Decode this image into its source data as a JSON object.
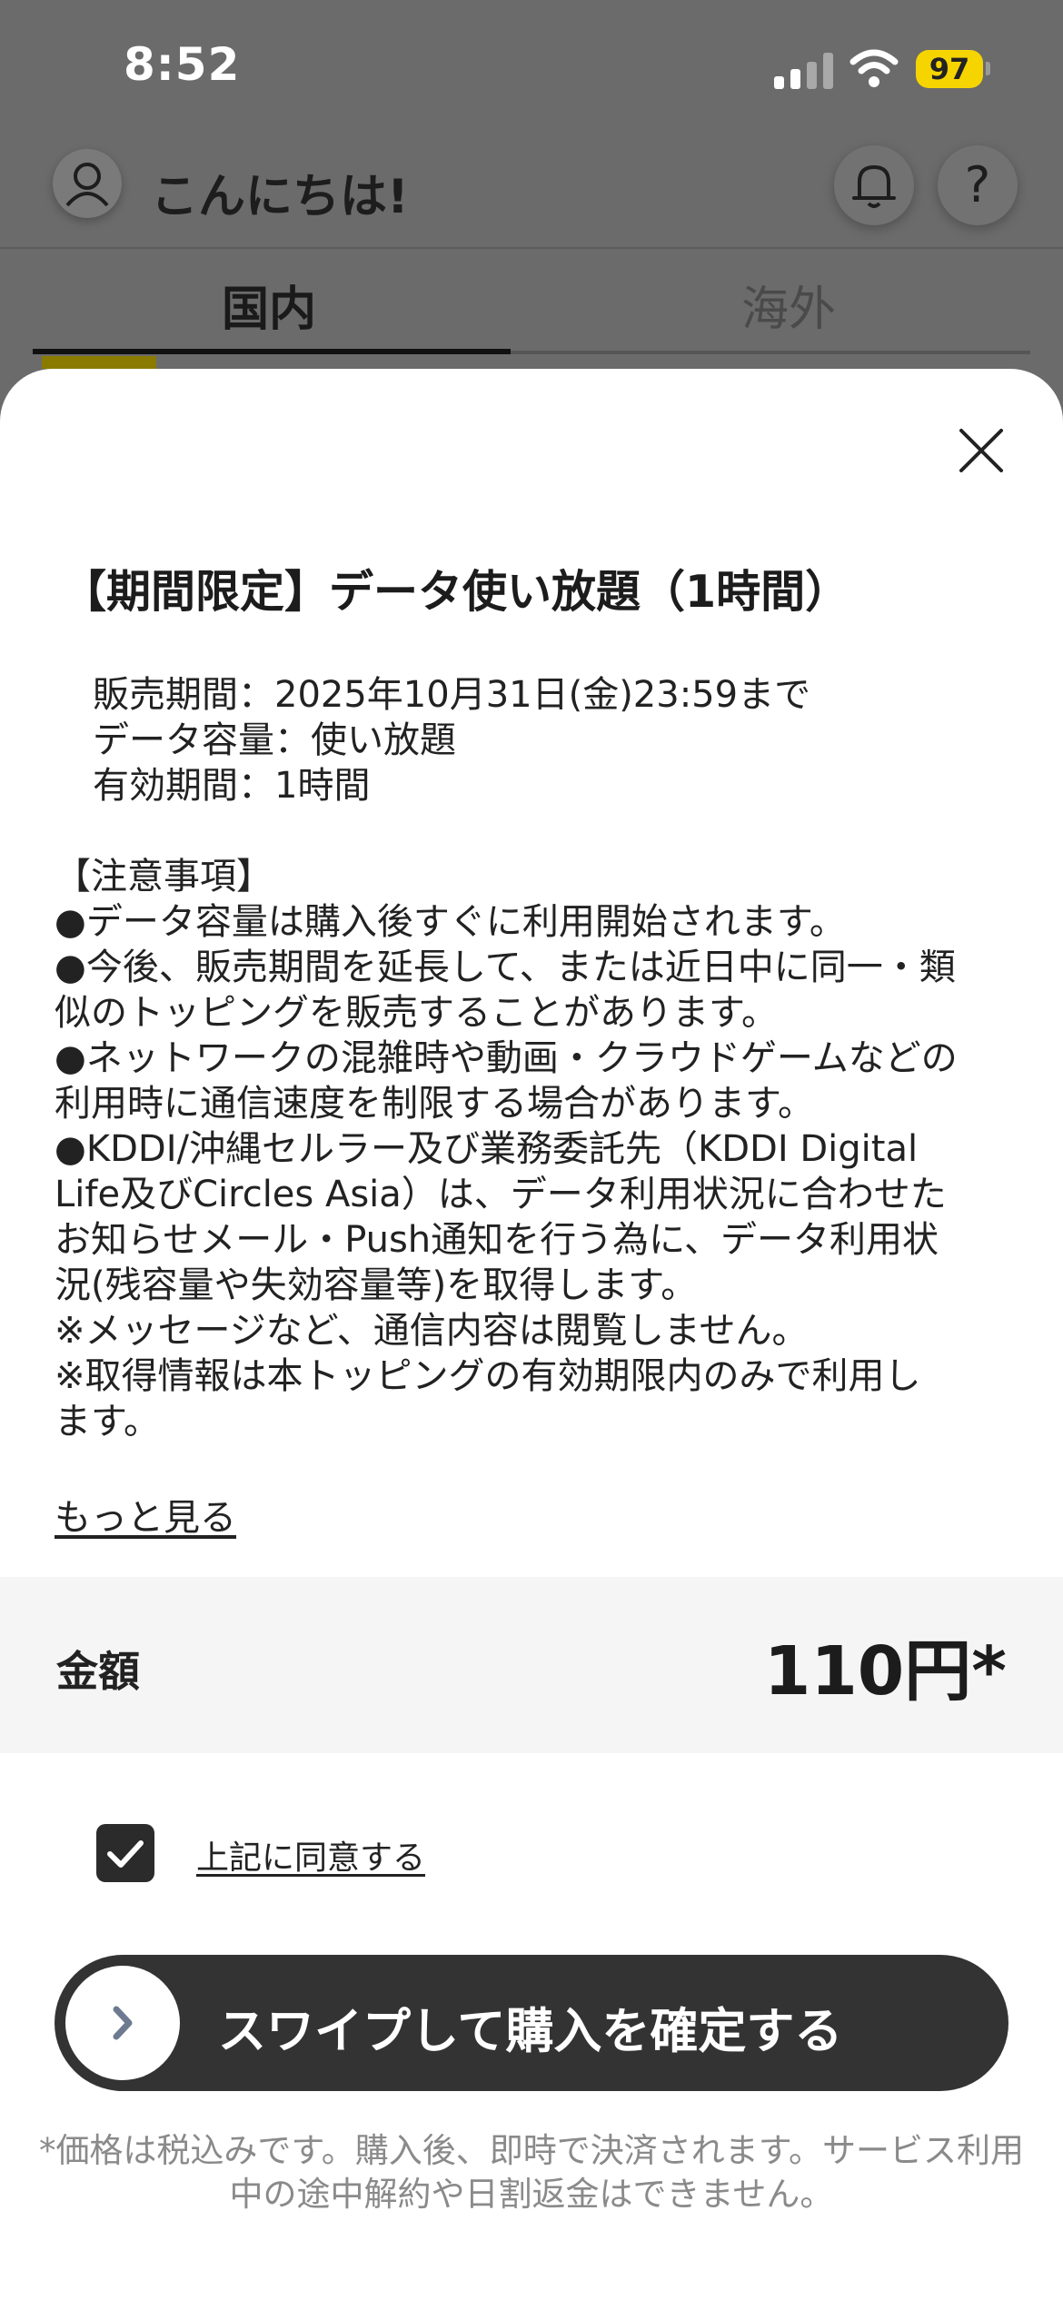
{
  "status_bar": {
    "time": "8:52",
    "battery": "97"
  },
  "header": {
    "greeting": "こんにちは!",
    "help_label": "?"
  },
  "tabs": [
    {
      "label": "国内",
      "active": true
    },
    {
      "label": "海外",
      "active": false
    }
  ],
  "sheet": {
    "title": "【期間限定】データ使い放題（1時間）",
    "summary": [
      "販売期間：2025年10月31日(金)23:59まで",
      "データ容量：使い放題",
      "有効期間：1時間"
    ],
    "notes": [
      "【注意事項】",
      "●データ容量は購入後すぐに利用開始されます。",
      "●今後、販売期間を延長して、または近日中に同一・類",
      "似のトッピングを販売することがあります。",
      "●ネットワークの混雑時や動画・クラウドゲームなどの",
      "利用時に通信速度を制限する場合があります。",
      "●KDDI/沖縄セルラー及び業務委託先（KDDI Digital",
      "Life及びCircles Asia）は、データ利用状況に合わせた",
      "お知らせメール・Push通知を行う為に、データ利用状",
      "況(残容量や失効容量等)を取得します。",
      "※メッセージなど、通信内容は閲覧しません。",
      "※取得情報は本トッピングの有効期限内のみで利用し",
      "ます。"
    ],
    "more_link": "もっと見る",
    "price_label": "金額",
    "price_value": "110円*",
    "agree_label": "上記に同意する",
    "agree_checked": true,
    "swipe_label": "スワイプして購入を確定する",
    "footnote": "*価格は税込みです。購入後、即時で決済されます。サービス利用中の途中解約や日割返金はできません。"
  },
  "colors": {
    "accent_yellow": "#f5d400",
    "sheet_bg": "#ffffff",
    "slider_bg": "#333333"
  }
}
